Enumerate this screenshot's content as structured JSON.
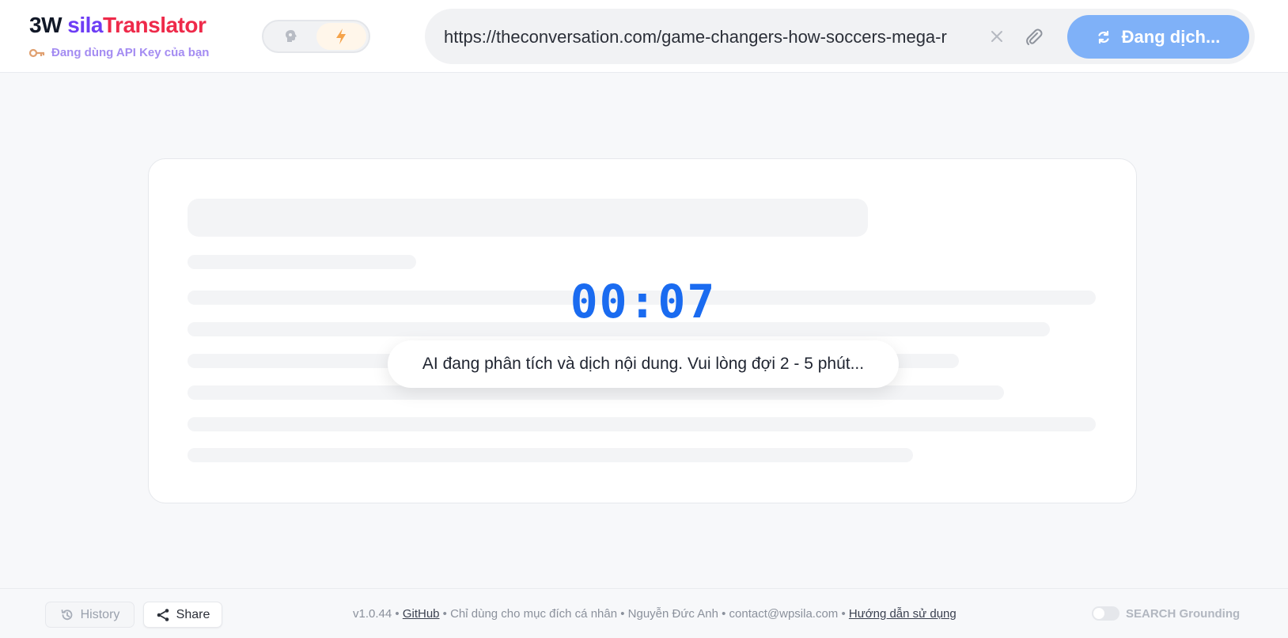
{
  "header": {
    "brand": {
      "part1": "3W ",
      "part2": "sila",
      "part3": "Translator"
    },
    "api_key_note": "Đang dùng API Key của bạn",
    "mode_toggle": {
      "left_icon": "brain-icon",
      "right_icon": "lightning-icon",
      "active": "right"
    },
    "url": {
      "value": "https://theconversation.com/game-changers-how-soccers-mega-r",
      "clear_icon": "close-icon",
      "attach_icon": "paperclip-icon"
    },
    "translate_button": {
      "label": "Đang dịch...",
      "icon": "refresh-icon"
    }
  },
  "main": {
    "timer": "00:07",
    "status": "AI đang phân tích và dịch nội dung. Vui lòng đợi 2 - 5 phút..."
  },
  "footer": {
    "history_label": "History",
    "share_label": "Share",
    "version": "v1.0.44",
    "github": "GitHub",
    "purpose": "Chỉ dùng cho mục đích cá nhân",
    "author": "Nguyễn Đức Anh",
    "email": "contact@wpsila.com",
    "guide": "Hướng dẫn sử dụng",
    "sep": " • ",
    "search_grounding": "SEARCH Grounding",
    "search_grounding_on": false
  },
  "colors": {
    "brand_sila": "#6d3df5",
    "brand_translator": "#ee2a4a",
    "accent_blue": "#1a6bf0",
    "button_disabled": "#7fb1f8"
  }
}
